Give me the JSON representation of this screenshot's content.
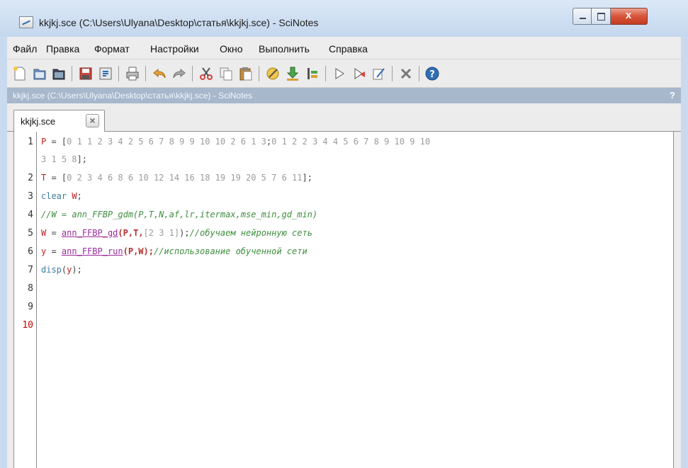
{
  "window": {
    "title": "kkjkj.sce (C:\\Users\\Ulyana\\Desktop\\статья\\kkjkj.sce) - SciNotes",
    "close_glyph": "x"
  },
  "menu": [
    "Файл",
    "Правка",
    "Формат",
    "Настройки",
    "Окно",
    "Выполнить",
    "Справка"
  ],
  "toolbar_icons": [
    "new-file-icon",
    "open-file-icon",
    "open-recent-icon",
    "save-icon",
    "save-as-icon",
    "print-icon",
    "undo-icon",
    "redo-icon",
    "cut-icon",
    "copy-icon",
    "paste-icon",
    "comment-icon",
    "load-into-scilab-icon",
    "execute-file-icon",
    "run-icon",
    "run-until-icon",
    "debug-icon",
    "tools-icon",
    "help-icon"
  ],
  "doc_header": {
    "path": "kkjkj.sce (C:\\Users\\Ulyana\\Desktop\\статья\\kkjkj.sce) - SciNotes",
    "help": "?"
  },
  "tab": {
    "label": "kkjkj.sce",
    "close": "×"
  },
  "line_numbers": [
    "1",
    "2",
    "3",
    "4",
    "5",
    "6",
    "7",
    "8",
    "9",
    "10"
  ],
  "code": {
    "l1_var": "P",
    "l1_op": " = [",
    "l1_nums_a": "0 1 1 2 3 4 2 5 6 7 8 9 9 10 10 2 6 1 3",
    "l1_semi": ";",
    "l1_nums_b": "0 1 2 2 3 4 4 5 6 7 8 9 10 9 10",
    "l1c_nums": "3 1 5 8",
    "l1c_end": "];",
    "l2_var": "T",
    "l2_op": " = [",
    "l2_nums": "0 2 3 4 6 8 6 10 12 14 16 18 19 19 20 5 7 6 11",
    "l2_end": "];",
    "l3_kw": "clear",
    "l3_arg": "W",
    "l3_end": ";",
    "l4_comment": "//W = ann_FFBP_gdm(P,T,N,af,lr,itermax,mse_min,gd_min)",
    "l5_var": "W",
    "l5_op": " = ",
    "l5_fn": "ann_FFBP_gd",
    "l5_a1": "(P,T,",
    "l5_a2": "[2 3 1]",
    "l5_a3": ");",
    "l5_comment": "//обучаем нейронную сеть",
    "l6_var": "y",
    "l6_op": " = ",
    "l6_fn": "ann_FFBP_run",
    "l6_args": "(P,W);",
    "l6_comment": "//использование обученной сети",
    "l7_kw": "disp",
    "l7_p1": "(",
    "l7_arg": "y",
    "l7_p2": ");"
  }
}
